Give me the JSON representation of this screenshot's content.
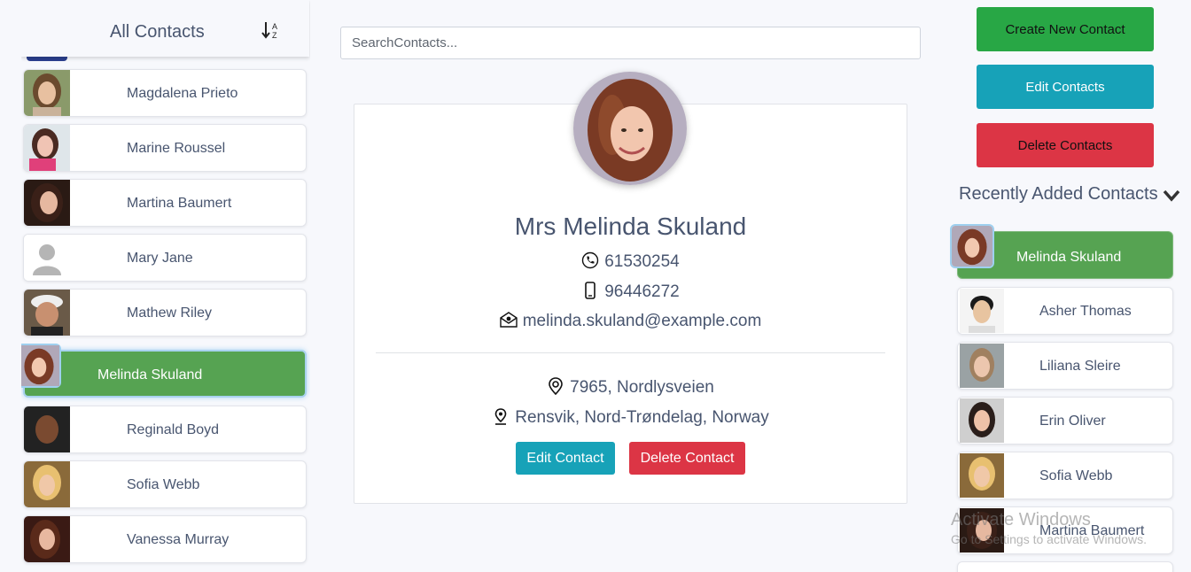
{
  "left_panel": {
    "title": "All Contacts",
    "sort_icon": "sort-alpha-down-icon",
    "contacts": [
      {
        "name": "Magdalena Prieto"
      },
      {
        "name": "Marine Roussel"
      },
      {
        "name": "Martina Baumert"
      },
      {
        "name": "Mary Jane"
      },
      {
        "name": "Mathew Riley"
      },
      {
        "name": "Melinda Skuland",
        "active": true
      },
      {
        "name": "Reginald Boyd"
      },
      {
        "name": "Sofia Webb"
      },
      {
        "name": "Vanessa Murray"
      }
    ]
  },
  "search": {
    "placeholder": "SearchContacts..."
  },
  "detail": {
    "name": "Mrs Melinda Skuland",
    "phone": "61530254",
    "cell": "96446272",
    "email": "melinda.skuland@example.com",
    "street": "7965, Nordlysveien",
    "location": "Rensvik, Nord-Trøndelag, Norway",
    "edit_label": "Edit Contact",
    "delete_label": "Delete Contact",
    "icons": [
      "phone-icon",
      "mobile-icon",
      "email-icon",
      "address-pin-icon",
      "location-pin-icon"
    ]
  },
  "right_panel": {
    "create_label": "Create New Contact",
    "edit_label": "Edit Contacts",
    "delete_label": "Delete Contacts",
    "recent_title": "Recently Added Contacts",
    "recent": [
      {
        "name": "Melinda Skuland",
        "active": true
      },
      {
        "name": "Asher Thomas"
      },
      {
        "name": "Liliana Sleire"
      },
      {
        "name": "Erin Oliver"
      },
      {
        "name": "Sofia Webb"
      },
      {
        "name": "Martina Baumert"
      }
    ]
  },
  "watermark": {
    "line1": "Activate Windows",
    "line2": "Go to Settings to activate Windows."
  },
  "colors": {
    "active_green": "#56a352",
    "teal": "#17a2b8",
    "red": "#dc3545",
    "green": "#28a745"
  }
}
